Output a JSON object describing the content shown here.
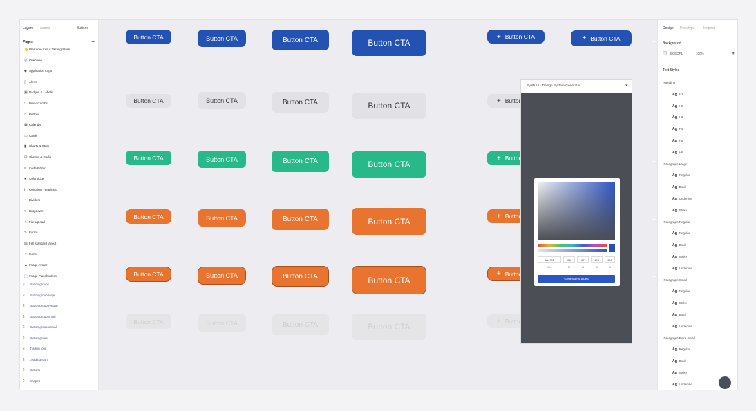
{
  "left": {
    "tabs": [
      "Layers",
      "Assets",
      "Buttons"
    ],
    "pages_label": "Pages",
    "pages": [
      {
        "icon": "wave-icon",
        "glyph": "👋",
        "label": "Welcome / Your Tasting Stock..."
      },
      {
        "icon": "target-icon",
        "glyph": "◎",
        "label": "Overview"
      },
      {
        "icon": "logo-icon",
        "glyph": "◆",
        "label": "Application Logo"
      },
      {
        "icon": "alert-icon",
        "glyph": "▯",
        "label": "Alerts"
      },
      {
        "icon": "badge-icon",
        "glyph": "▣",
        "label": "Badges & Labels"
      },
      {
        "icon": "breadcrumb-icon",
        "glyph": "⁄",
        "label": "Breadcrumbs"
      },
      {
        "icon": "buttons-icon",
        "glyph": "○",
        "label": "Buttons",
        "selected": true
      },
      {
        "icon": "calendar-icon",
        "glyph": "▦",
        "label": "Calendar"
      },
      {
        "icon": "cards-icon",
        "glyph": "▭",
        "label": "Cards"
      },
      {
        "icon": "chart-icon",
        "glyph": "▮",
        "label": "Charts & Stats"
      },
      {
        "icon": "check-icon",
        "glyph": "☑",
        "label": "Checks & Radio"
      },
      {
        "icon": "code-icon",
        "glyph": "≡",
        "label": "Code Editor"
      },
      {
        "icon": "colorpicker-icon",
        "glyph": "●",
        "label": "Colorpicker"
      },
      {
        "icon": "heading-icon",
        "glyph": "Ⅰ",
        "label": "Container Headings"
      },
      {
        "icon": "divider-icon",
        "glyph": "⁃",
        "label": "Dividers"
      },
      {
        "icon": "dropdown-icon",
        "glyph": "▿",
        "label": "Dropdown"
      },
      {
        "icon": "upload-icon",
        "glyph": "⇧",
        "label": "File Upload"
      },
      {
        "icon": "forms-icon",
        "glyph": "✎",
        "label": "Forms"
      },
      {
        "icon": "layout-icon",
        "glyph": "▤",
        "label": "Full standard layout"
      },
      {
        "icon": "icons-icon",
        "glyph": "✦",
        "label": "Icons"
      },
      {
        "icon": "image-icon",
        "glyph": "▲",
        "label": "Image Avatar"
      },
      {
        "icon": "placeholder-icon",
        "glyph": "⬚",
        "label": "Image Placeholders"
      }
    ],
    "components": [
      {
        "icon": "component-icon",
        "label": "Button groups"
      },
      {
        "icon": "component-icon",
        "label": "Button group large"
      },
      {
        "icon": "component-icon",
        "label": "Button group regular"
      },
      {
        "icon": "component-icon",
        "label": "Button group small"
      },
      {
        "icon": "component-icon",
        "label": "Button group xsmall"
      },
      {
        "icon": "component-icon",
        "label": "Button group"
      },
      {
        "icon": "component-icon",
        "label": "Trailing Icon"
      },
      {
        "icon": "component-icon",
        "label": "Leading Icon"
      },
      {
        "icon": "component-icon",
        "label": "Buttons"
      },
      {
        "icon": "component-icon",
        "label": "Shapes"
      }
    ]
  },
  "canvas": {
    "button_label": "Button CTA",
    "plus_glyph": "+",
    "colors": {
      "blue": "#2452b2",
      "green": "#27b98a",
      "orange": "#e8742f",
      "grey": "#e2e2e6",
      "canvas": "#ececf1"
    }
  },
  "plugin": {
    "title": "Synth UI · Design System Generator",
    "close_glyph": "×",
    "fields": [
      {
        "value": "1A4792",
        "label": "Hex"
      },
      {
        "value": "26",
        "label": "R"
      },
      {
        "value": "67",
        "label": "G"
      },
      {
        "value": "178",
        "label": "B"
      },
      {
        "value": "100",
        "label": "A"
      }
    ],
    "generate_label": "Generate shades"
  },
  "right": {
    "tabs": [
      "Design",
      "Prototype",
      "Inspect"
    ],
    "background_label": "Background",
    "background_hex": "ECECF1",
    "background_opacity": "100%",
    "text_styles_label": "Text Styles",
    "text_styles": [
      {
        "type": "group",
        "label": "Heading"
      },
      {
        "type": "item",
        "label": "H1"
      },
      {
        "type": "item",
        "label": "H2"
      },
      {
        "type": "item",
        "label": "H3"
      },
      {
        "type": "item",
        "label": "H4"
      },
      {
        "type": "item",
        "label": "H5"
      },
      {
        "type": "item",
        "label": "H6"
      },
      {
        "type": "group",
        "label": "Paragraph Large"
      },
      {
        "type": "item",
        "label": "Regular"
      },
      {
        "type": "item",
        "label": "Bold"
      },
      {
        "type": "item",
        "label": "Underline"
      },
      {
        "type": "item",
        "label": "Strike"
      },
      {
        "type": "group",
        "label": "Paragraph Regular"
      },
      {
        "type": "item",
        "label": "Regular"
      },
      {
        "type": "item",
        "label": "Bold"
      },
      {
        "type": "item",
        "label": "Strike"
      },
      {
        "type": "item",
        "label": "Underline"
      },
      {
        "type": "group",
        "label": "Paragraph Small"
      },
      {
        "type": "item",
        "label": "Regular"
      },
      {
        "type": "item",
        "label": "Strike"
      },
      {
        "type": "item",
        "label": "Bold"
      },
      {
        "type": "item",
        "label": "Underline"
      },
      {
        "type": "group",
        "label": "Paragraph Extra Small"
      },
      {
        "type": "item",
        "label": "Regular"
      },
      {
        "type": "item",
        "label": "Bold"
      },
      {
        "type": "item",
        "label": "Strike"
      },
      {
        "type": "item",
        "label": "Underline"
      }
    ]
  }
}
